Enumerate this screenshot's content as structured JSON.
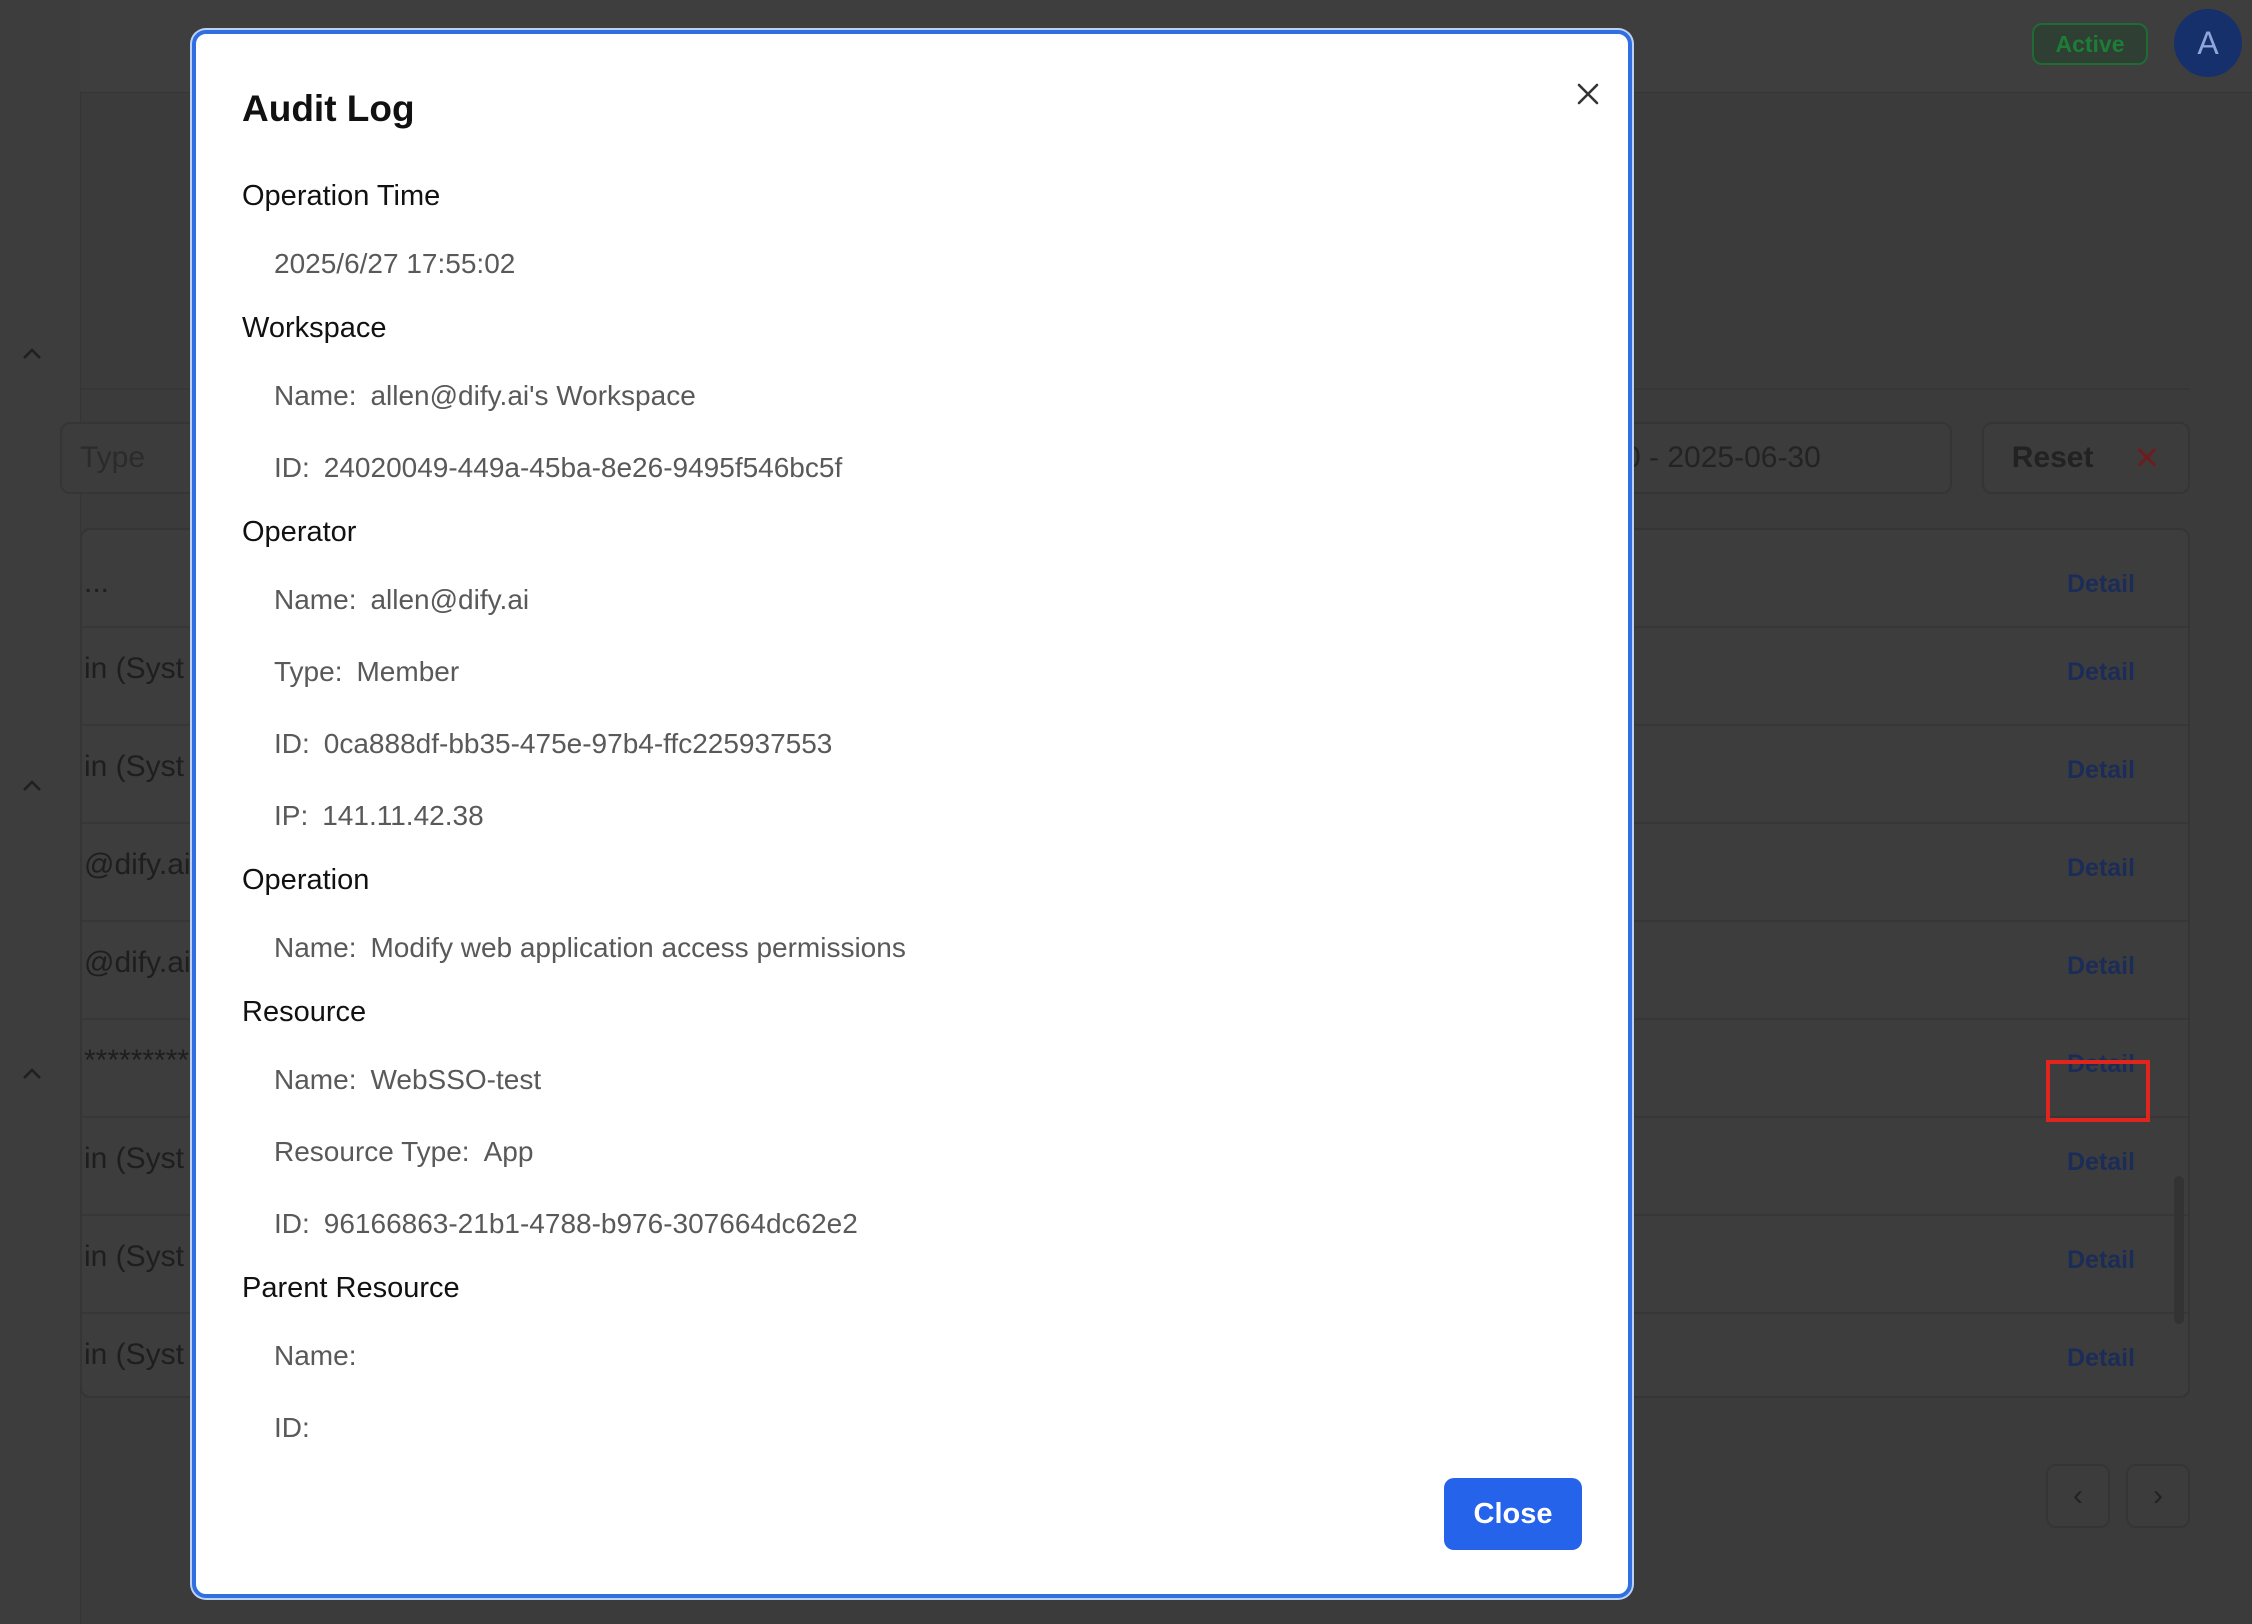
{
  "background": {
    "status_badge": "Active",
    "avatar_letter": "A",
    "filter_type_label": "Type",
    "filter_date_range": "0 - 2025-06-30",
    "reset_label": "Reset",
    "table_rows": [
      {
        "left": "...",
        "detail": "Detail"
      },
      {
        "left": "in  (Syst",
        "detail": "Detail"
      },
      {
        "left": "in  (Syst",
        "detail": "Detail"
      },
      {
        "left": "@dify.ai",
        "detail": "Detail"
      },
      {
        "left": "@dify.ai",
        "detail": "Detail"
      },
      {
        "left": "*********",
        "detail": "Detail"
      },
      {
        "left": "in  (Syst",
        "detail": "Detail"
      },
      {
        "left": "in  (Syst",
        "detail": "Detail"
      },
      {
        "left": "in  (Syst",
        "detail": "Detail"
      }
    ],
    "pager_prev": "‹",
    "pager_next": "›"
  },
  "modal": {
    "title": "Audit Log",
    "close_button_label": "Close",
    "operation_time": {
      "title": "Operation Time",
      "value": "2025/6/27 17:55:02"
    },
    "workspace": {
      "title": "Workspace",
      "name_label": "Name:",
      "name": "allen@dify.ai's Workspace",
      "id_label": "ID:",
      "id": "24020049-449a-45ba-8e26-9495f546bc5f"
    },
    "operator": {
      "title": "Operator",
      "name_label": "Name:",
      "name": "allen@dify.ai",
      "type_label": "Type:",
      "type": "Member",
      "id_label": "ID:",
      "id": "0ca888df-bb35-475e-97b4-ffc225937553",
      "ip_label": "IP:",
      "ip": "141.11.42.38"
    },
    "operation": {
      "title": "Operation",
      "name_label": "Name:",
      "name": "Modify web application access permissions"
    },
    "resource": {
      "title": "Resource",
      "name_label": "Name:",
      "name": "WebSSO-test",
      "type_label": "Resource Type:",
      "type": "App",
      "id_label": "ID:",
      "id": "96166863-21b1-4788-b976-307664dc62e2"
    },
    "parent_resource": {
      "title": "Parent Resource",
      "name_label": "Name:",
      "name": "",
      "id_label": "ID:",
      "id": ""
    }
  }
}
